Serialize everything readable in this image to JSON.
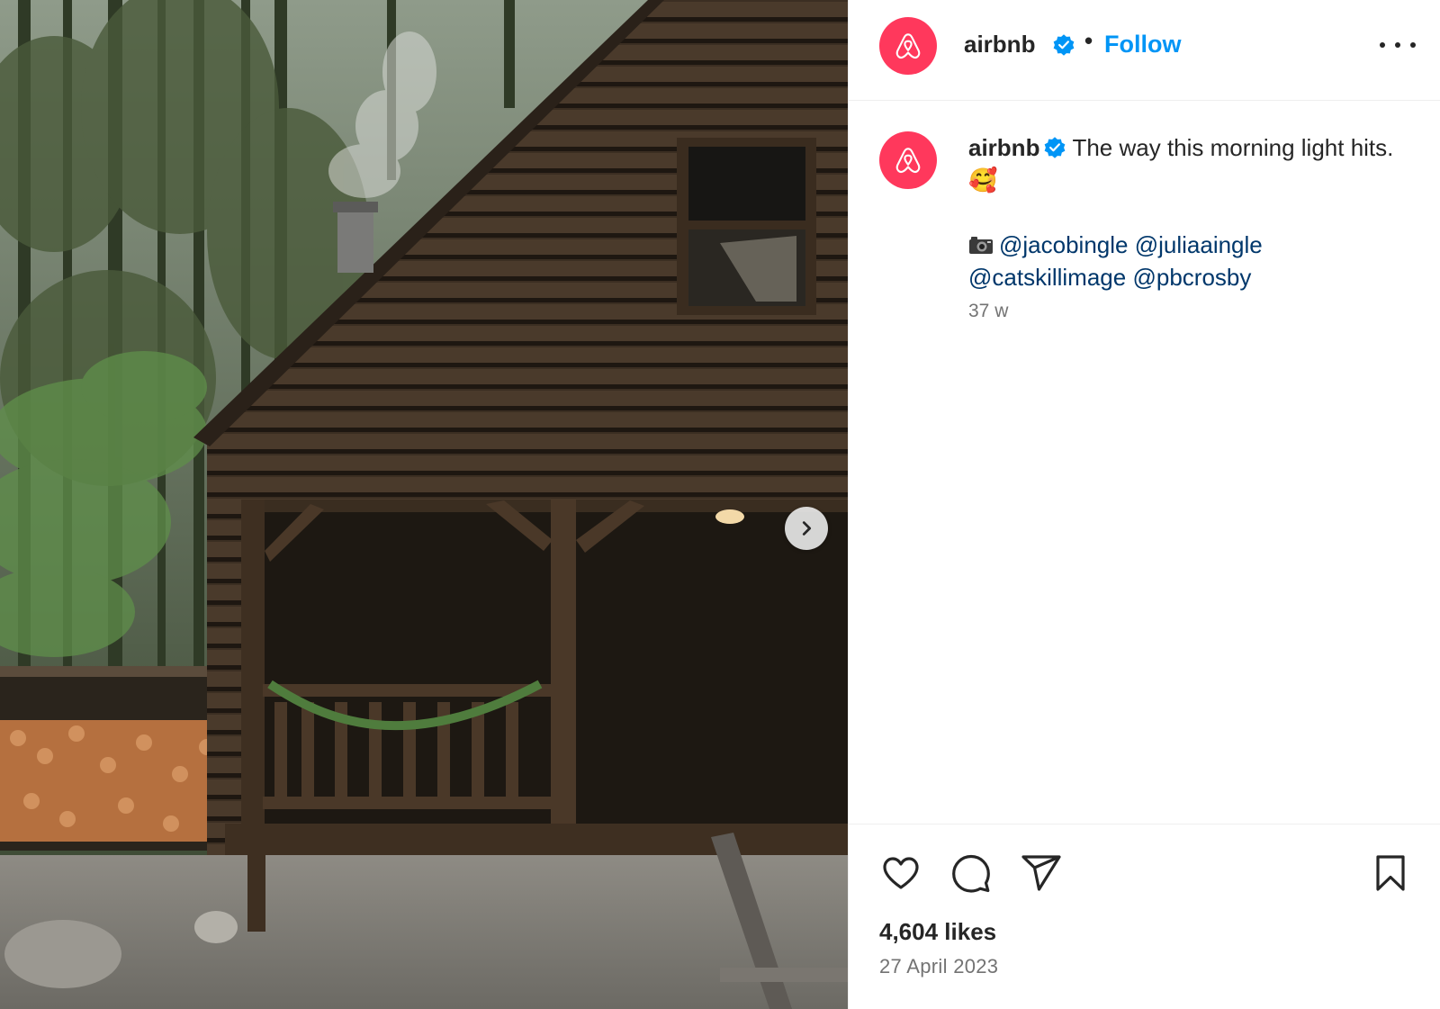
{
  "post": {
    "account": {
      "username": "airbnb",
      "verified": true,
      "avatar_icon": "airbnb-logo-icon",
      "avatar_color": "#ff385c"
    },
    "header": {
      "separator": "•",
      "follow_label": "Follow",
      "more_icon": "more-options-icon"
    },
    "caption": {
      "username": "airbnb",
      "text_line": "The way this morning light hits.",
      "emoji": "🥰",
      "camera_icon": "camera-icon",
      "mentions": [
        "@jacobingle",
        "@juliaaingle",
        "@catskillimage",
        "@pbcrosby"
      ],
      "time_ago": "37 w"
    },
    "media": {
      "next_icon": "chevron-right-icon"
    },
    "actions": {
      "like_icon": "heart-icon",
      "comment_icon": "comment-icon",
      "share_icon": "share-icon",
      "save_icon": "bookmark-icon"
    },
    "likes_text": "4,604 likes",
    "date_text": "27 April 2023",
    "colors": {
      "follow_blue": "#0095f6",
      "mention_blue": "#00376b",
      "verified_blue": "#0095f6",
      "secondary_text": "#737373"
    }
  }
}
